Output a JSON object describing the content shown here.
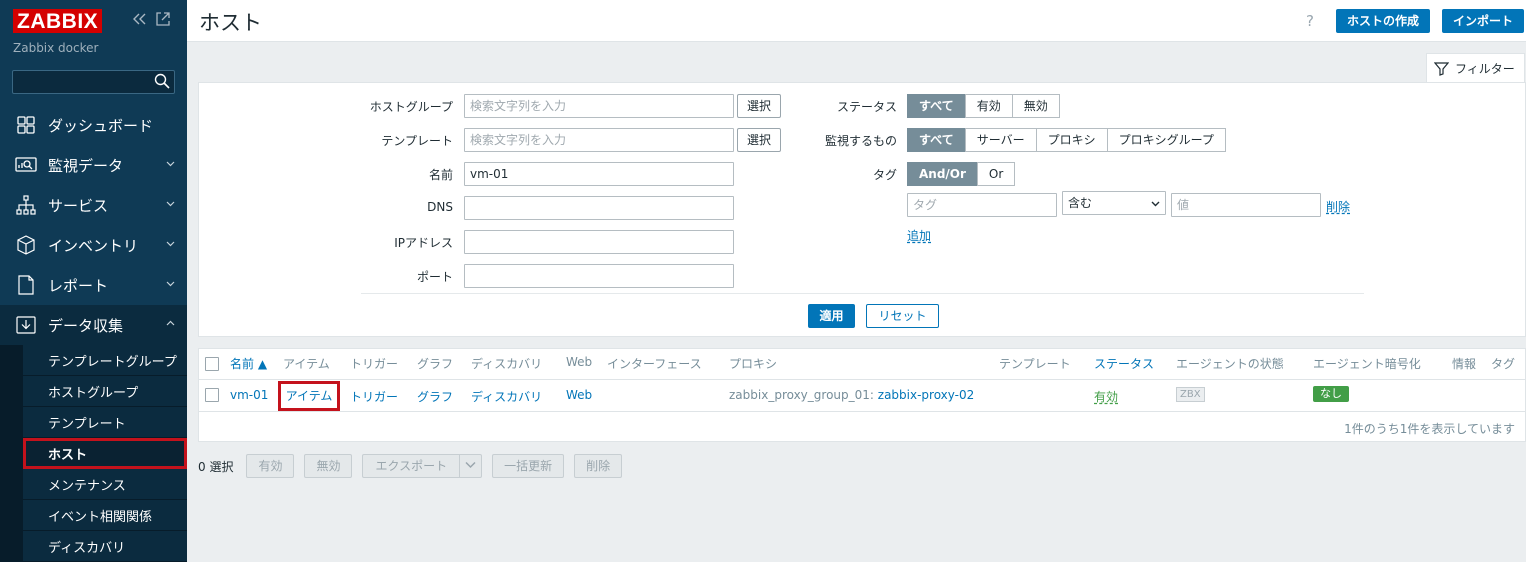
{
  "app": {
    "logo": "ZABBIX",
    "instance": "Zabbix docker"
  },
  "sidebar": {
    "items": [
      {
        "label": "ダッシュボード"
      },
      {
        "label": "監視データ"
      },
      {
        "label": "サービス"
      },
      {
        "label": "インベントリ"
      },
      {
        "label": "レポート"
      },
      {
        "label": "データ収集"
      }
    ],
    "submenu": [
      {
        "label": "テンプレートグループ"
      },
      {
        "label": "ホストグループ"
      },
      {
        "label": "テンプレート"
      },
      {
        "label": "ホスト"
      },
      {
        "label": "メンテナンス"
      },
      {
        "label": "イベント相関関係"
      },
      {
        "label": "ディスカバリ"
      }
    ]
  },
  "header": {
    "title": "ホスト",
    "help": "?",
    "create_label": "ホストの作成",
    "import_label": "インポート"
  },
  "filter": {
    "tab_label": "フィルター",
    "host_group_label": "ホストグループ",
    "host_group_placeholder": "検索文字列を入力",
    "template_label": "テンプレート",
    "template_placeholder": "検索文字列を入力",
    "select_label": "選択",
    "name_label": "名前",
    "name_value": "vm-01",
    "dns_label": "DNS",
    "ip_label": "IPアドレス",
    "port_label": "ポート",
    "status_label": "ステータス",
    "status_options": [
      "すべて",
      "有効",
      "無効"
    ],
    "monitored_label": "監視するもの",
    "monitored_options": [
      "すべて",
      "サーバー",
      "プロキシ",
      "プロキシグループ"
    ],
    "tag_label": "タグ",
    "tag_mode_options": [
      "And/Or",
      "Or"
    ],
    "tag_placeholder": "タグ",
    "tag_operator": "含む",
    "value_placeholder": "値",
    "remove_label": "削除",
    "add_label": "追加",
    "apply_label": "適用",
    "reset_label": "リセット"
  },
  "table": {
    "headers": {
      "name": "名前 ▲",
      "items": "アイテム",
      "triggers": "トリガー",
      "graphs": "グラフ",
      "discovery": "ディスカバリ",
      "web": "Web",
      "interface": "インターフェース",
      "proxy": "プロキシ",
      "templates": "テンプレート",
      "status": "ステータス",
      "agent_status": "エージェントの状態",
      "agent_encryption": "エージェント暗号化",
      "info": "情報",
      "tags": "タグ"
    },
    "rows": [
      {
        "name": "vm-01",
        "items": "アイテム",
        "triggers": "トリガー",
        "graphs": "グラフ",
        "discovery": "ディスカバリ",
        "web": "Web",
        "proxy_group": "zabbix_proxy_group_01",
        "proxy_sep": ": ",
        "proxy": "zabbix-proxy-02",
        "status": "有効",
        "agent_status": "ZBX",
        "encryption": "なし"
      }
    ],
    "footer": "1件のうち1件を表示しています"
  },
  "actions": {
    "selected": "0 選択",
    "enable": "有効",
    "disable": "無効",
    "export": "エクスポート",
    "mass_update": "一括更新",
    "delete": "削除"
  },
  "colors": {
    "sidebar": "#0f3a55",
    "accent": "#0275b8",
    "highlight": "#c4121c",
    "status_ok": "#429e47"
  }
}
